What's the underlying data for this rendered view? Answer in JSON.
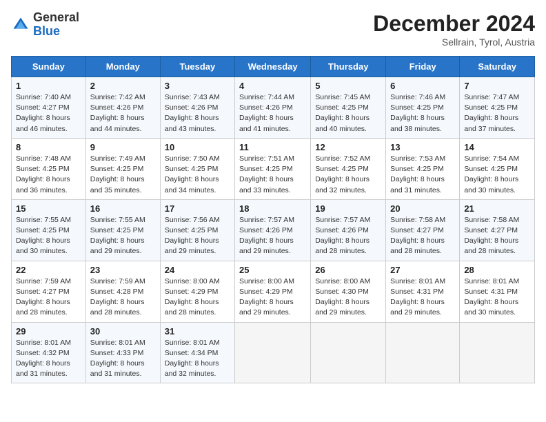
{
  "header": {
    "logo_line1": "General",
    "logo_line2": "Blue",
    "month": "December 2024",
    "location": "Sellrain, Tyrol, Austria"
  },
  "weekdays": [
    "Sunday",
    "Monday",
    "Tuesday",
    "Wednesday",
    "Thursday",
    "Friday",
    "Saturday"
  ],
  "weeks": [
    [
      {
        "day": "1",
        "sunrise": "Sunrise: 7:40 AM",
        "sunset": "Sunset: 4:27 PM",
        "daylight": "Daylight: 8 hours and 46 minutes."
      },
      {
        "day": "2",
        "sunrise": "Sunrise: 7:42 AM",
        "sunset": "Sunset: 4:26 PM",
        "daylight": "Daylight: 8 hours and 44 minutes."
      },
      {
        "day": "3",
        "sunrise": "Sunrise: 7:43 AM",
        "sunset": "Sunset: 4:26 PM",
        "daylight": "Daylight: 8 hours and 43 minutes."
      },
      {
        "day": "4",
        "sunrise": "Sunrise: 7:44 AM",
        "sunset": "Sunset: 4:26 PM",
        "daylight": "Daylight: 8 hours and 41 minutes."
      },
      {
        "day": "5",
        "sunrise": "Sunrise: 7:45 AM",
        "sunset": "Sunset: 4:25 PM",
        "daylight": "Daylight: 8 hours and 40 minutes."
      },
      {
        "day": "6",
        "sunrise": "Sunrise: 7:46 AM",
        "sunset": "Sunset: 4:25 PM",
        "daylight": "Daylight: 8 hours and 38 minutes."
      },
      {
        "day": "7",
        "sunrise": "Sunrise: 7:47 AM",
        "sunset": "Sunset: 4:25 PM",
        "daylight": "Daylight: 8 hours and 37 minutes."
      }
    ],
    [
      {
        "day": "8",
        "sunrise": "Sunrise: 7:48 AM",
        "sunset": "Sunset: 4:25 PM",
        "daylight": "Daylight: 8 hours and 36 minutes."
      },
      {
        "day": "9",
        "sunrise": "Sunrise: 7:49 AM",
        "sunset": "Sunset: 4:25 PM",
        "daylight": "Daylight: 8 hours and 35 minutes."
      },
      {
        "day": "10",
        "sunrise": "Sunrise: 7:50 AM",
        "sunset": "Sunset: 4:25 PM",
        "daylight": "Daylight: 8 hours and 34 minutes."
      },
      {
        "day": "11",
        "sunrise": "Sunrise: 7:51 AM",
        "sunset": "Sunset: 4:25 PM",
        "daylight": "Daylight: 8 hours and 33 minutes."
      },
      {
        "day": "12",
        "sunrise": "Sunrise: 7:52 AM",
        "sunset": "Sunset: 4:25 PM",
        "daylight": "Daylight: 8 hours and 32 minutes."
      },
      {
        "day": "13",
        "sunrise": "Sunrise: 7:53 AM",
        "sunset": "Sunset: 4:25 PM",
        "daylight": "Daylight: 8 hours and 31 minutes."
      },
      {
        "day": "14",
        "sunrise": "Sunrise: 7:54 AM",
        "sunset": "Sunset: 4:25 PM",
        "daylight": "Daylight: 8 hours and 30 minutes."
      }
    ],
    [
      {
        "day": "15",
        "sunrise": "Sunrise: 7:55 AM",
        "sunset": "Sunset: 4:25 PM",
        "daylight": "Daylight: 8 hours and 30 minutes."
      },
      {
        "day": "16",
        "sunrise": "Sunrise: 7:55 AM",
        "sunset": "Sunset: 4:25 PM",
        "daylight": "Daylight: 8 hours and 29 minutes."
      },
      {
        "day": "17",
        "sunrise": "Sunrise: 7:56 AM",
        "sunset": "Sunset: 4:25 PM",
        "daylight": "Daylight: 8 hours and 29 minutes."
      },
      {
        "day": "18",
        "sunrise": "Sunrise: 7:57 AM",
        "sunset": "Sunset: 4:26 PM",
        "daylight": "Daylight: 8 hours and 29 minutes."
      },
      {
        "day": "19",
        "sunrise": "Sunrise: 7:57 AM",
        "sunset": "Sunset: 4:26 PM",
        "daylight": "Daylight: 8 hours and 28 minutes."
      },
      {
        "day": "20",
        "sunrise": "Sunrise: 7:58 AM",
        "sunset": "Sunset: 4:27 PM",
        "daylight": "Daylight: 8 hours and 28 minutes."
      },
      {
        "day": "21",
        "sunrise": "Sunrise: 7:58 AM",
        "sunset": "Sunset: 4:27 PM",
        "daylight": "Daylight: 8 hours and 28 minutes."
      }
    ],
    [
      {
        "day": "22",
        "sunrise": "Sunrise: 7:59 AM",
        "sunset": "Sunset: 4:27 PM",
        "daylight": "Daylight: 8 hours and 28 minutes."
      },
      {
        "day": "23",
        "sunrise": "Sunrise: 7:59 AM",
        "sunset": "Sunset: 4:28 PM",
        "daylight": "Daylight: 8 hours and 28 minutes."
      },
      {
        "day": "24",
        "sunrise": "Sunrise: 8:00 AM",
        "sunset": "Sunset: 4:29 PM",
        "daylight": "Daylight: 8 hours and 28 minutes."
      },
      {
        "day": "25",
        "sunrise": "Sunrise: 8:00 AM",
        "sunset": "Sunset: 4:29 PM",
        "daylight": "Daylight: 8 hours and 29 minutes."
      },
      {
        "day": "26",
        "sunrise": "Sunrise: 8:00 AM",
        "sunset": "Sunset: 4:30 PM",
        "daylight": "Daylight: 8 hours and 29 minutes."
      },
      {
        "day": "27",
        "sunrise": "Sunrise: 8:01 AM",
        "sunset": "Sunset: 4:31 PM",
        "daylight": "Daylight: 8 hours and 29 minutes."
      },
      {
        "day": "28",
        "sunrise": "Sunrise: 8:01 AM",
        "sunset": "Sunset: 4:31 PM",
        "daylight": "Daylight: 8 hours and 30 minutes."
      }
    ],
    [
      {
        "day": "29",
        "sunrise": "Sunrise: 8:01 AM",
        "sunset": "Sunset: 4:32 PM",
        "daylight": "Daylight: 8 hours and 31 minutes."
      },
      {
        "day": "30",
        "sunrise": "Sunrise: 8:01 AM",
        "sunset": "Sunset: 4:33 PM",
        "daylight": "Daylight: 8 hours and 31 minutes."
      },
      {
        "day": "31",
        "sunrise": "Sunrise: 8:01 AM",
        "sunset": "Sunset: 4:34 PM",
        "daylight": "Daylight: 8 hours and 32 minutes."
      },
      null,
      null,
      null,
      null
    ]
  ]
}
